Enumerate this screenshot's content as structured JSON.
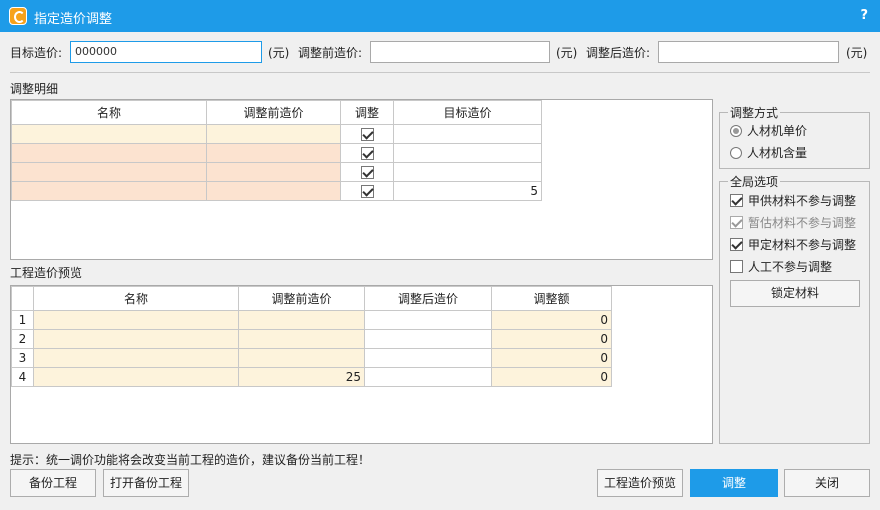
{
  "window": {
    "title": "指定造价调整",
    "help": "?"
  },
  "top": {
    "target_label": "目标造价:",
    "target_value": "000000",
    "unit": "(元)",
    "before_label": "调整前造价:",
    "before_value": "",
    "after_label": "调整后造价:",
    "after_value": ""
  },
  "detail": {
    "section_label": "调整明细",
    "columns": [
      "名称",
      "调整前造价",
      "调整",
      "目标造价"
    ],
    "rows": [
      {
        "name": "",
        "before": "",
        "adjust": true,
        "target": ""
      },
      {
        "name": "",
        "before": "",
        "adjust": true,
        "target": ""
      },
      {
        "name": "",
        "before": "",
        "adjust": true,
        "target": ""
      },
      {
        "name": "",
        "before": "",
        "adjust": true,
        "target": "5"
      }
    ]
  },
  "preview": {
    "section_label": "工程造价预览",
    "columns": [
      "",
      "名称",
      "调整前造价",
      "调整后造价",
      "调整额"
    ],
    "rows": [
      {
        "no": "1",
        "name": "",
        "before": "",
        "after": "",
        "diff": "0"
      },
      {
        "no": "2",
        "name": "",
        "before": "",
        "after": "",
        "diff": "0"
      },
      {
        "no": "3",
        "name": "",
        "before": "",
        "after": "",
        "diff": "0"
      },
      {
        "no": "4",
        "name": "",
        "before": "25",
        "after": "",
        "diff": "0"
      }
    ]
  },
  "adjust_method": {
    "legend": "调整方式",
    "options": [
      {
        "label": "人材机单价",
        "selected": true
      },
      {
        "label": "人材机含量",
        "selected": false
      }
    ]
  },
  "global_options": {
    "legend": "全局选项",
    "items": [
      {
        "label": "甲供材料不参与调整",
        "checked": true,
        "disabled": false
      },
      {
        "label": "暂估材料不参与调整",
        "checked": true,
        "disabled": true
      },
      {
        "label": "甲定材料不参与调整",
        "checked": true,
        "disabled": false
      },
      {
        "label": "人工不参与调整",
        "checked": false,
        "disabled": false
      }
    ],
    "lock_button": "锁定材料"
  },
  "hint": "提示：统一调价功能将会改变当前工程的造价，建议备份当前工程！",
  "buttons": {
    "backup": "备份工程",
    "open_backup": "打开备份工程",
    "preview": "工程造价预览",
    "adjust": "调整",
    "close": "关闭"
  }
}
